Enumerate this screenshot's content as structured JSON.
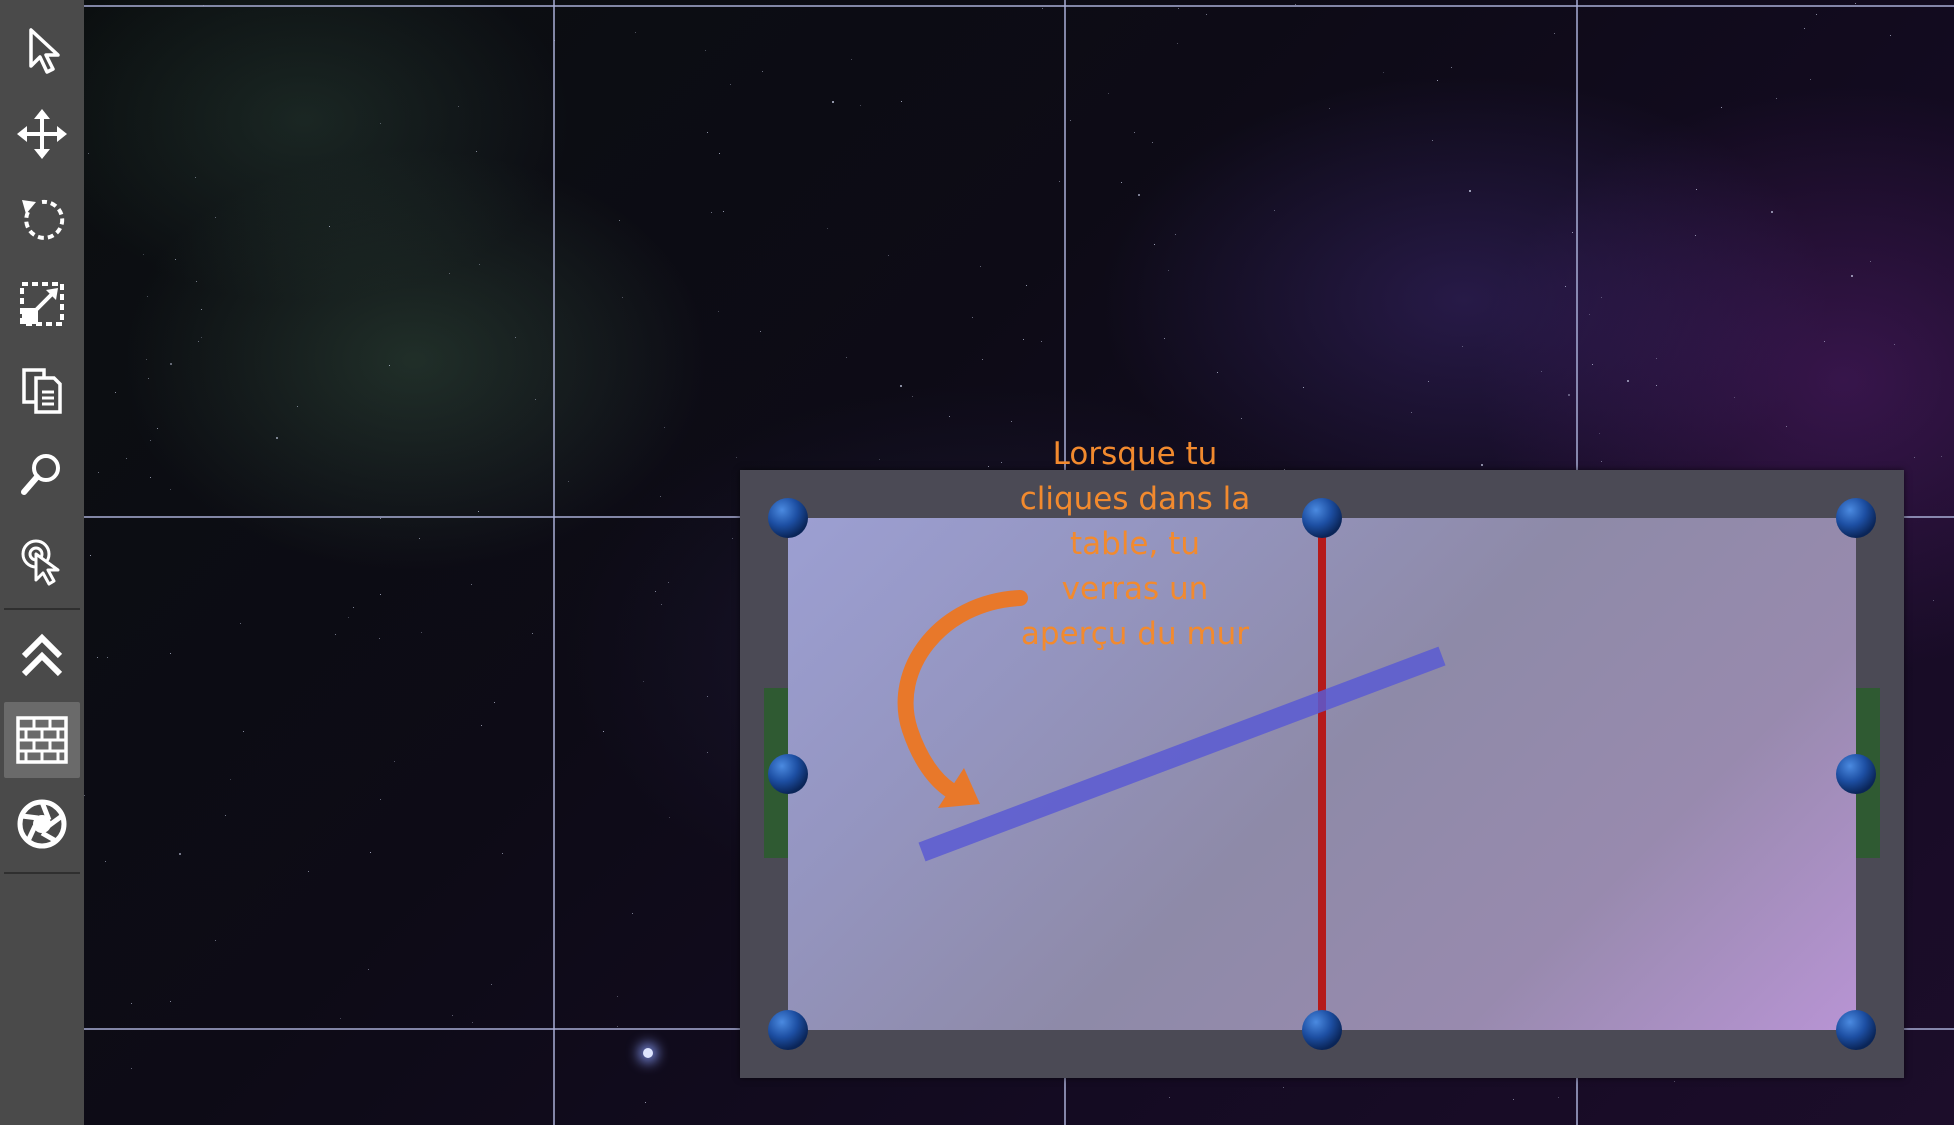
{
  "toolbar": {
    "tools": [
      {
        "name": "select",
        "icon": "cursor-arrow-icon",
        "active": false
      },
      {
        "name": "move",
        "icon": "move-arrows-icon",
        "active": false
      },
      {
        "name": "rotate",
        "icon": "rotate-icon",
        "active": false
      },
      {
        "name": "scale",
        "icon": "scale-icon",
        "active": false
      },
      {
        "name": "duplicate",
        "icon": "copy-documents-icon",
        "active": false
      },
      {
        "name": "zoom",
        "icon": "magnifier-icon",
        "active": false
      },
      {
        "name": "pointer-select",
        "icon": "pointer-click-icon",
        "active": false
      },
      {
        "name": "level-up",
        "icon": "double-chevron-up-icon",
        "active": false
      },
      {
        "name": "wall",
        "icon": "brick-wall-icon",
        "active": true
      },
      {
        "name": "portal",
        "icon": "aperture-icon",
        "active": false
      }
    ]
  },
  "annotation": {
    "text": "Lorsque tu\ncliques dans la\ntable, tu\nverras un\naperçu du mur"
  },
  "colors": {
    "annotation": "#f28a2e",
    "wall_preview": "#5a5ad2",
    "divider_line": "#b51a1a",
    "corner_handle": "#1d4fa3",
    "side_handle": "#2f5a32",
    "toolbar_bg": "#4a4a4a",
    "grid": "#aaafd7"
  }
}
